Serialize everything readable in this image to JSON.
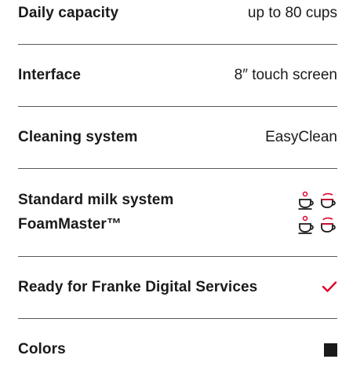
{
  "specs": [
    {
      "label": "Daily capacity",
      "value": "up to 80 cups"
    },
    {
      "label": "Interface",
      "value": "8″ touch screen"
    },
    {
      "label": "Cleaning system",
      "value": "EasyClean"
    },
    {
      "labels": [
        "Standard milk system",
        "FoamMaster™"
      ]
    },
    {
      "label": "Ready for Franke Digital Services"
    },
    {
      "label": "Colors"
    }
  ],
  "icons": {
    "milk_system": [
      "cappuccino-cup-icon",
      "latte-glass-icon"
    ],
    "ready": "checkmark-icon",
    "color": "black-swatch-icon"
  },
  "colors": {
    "accent": "#e1002a",
    "text": "#1a1a1a",
    "divider": "#5a5a5a",
    "swatch": "#1a1a1a"
  }
}
